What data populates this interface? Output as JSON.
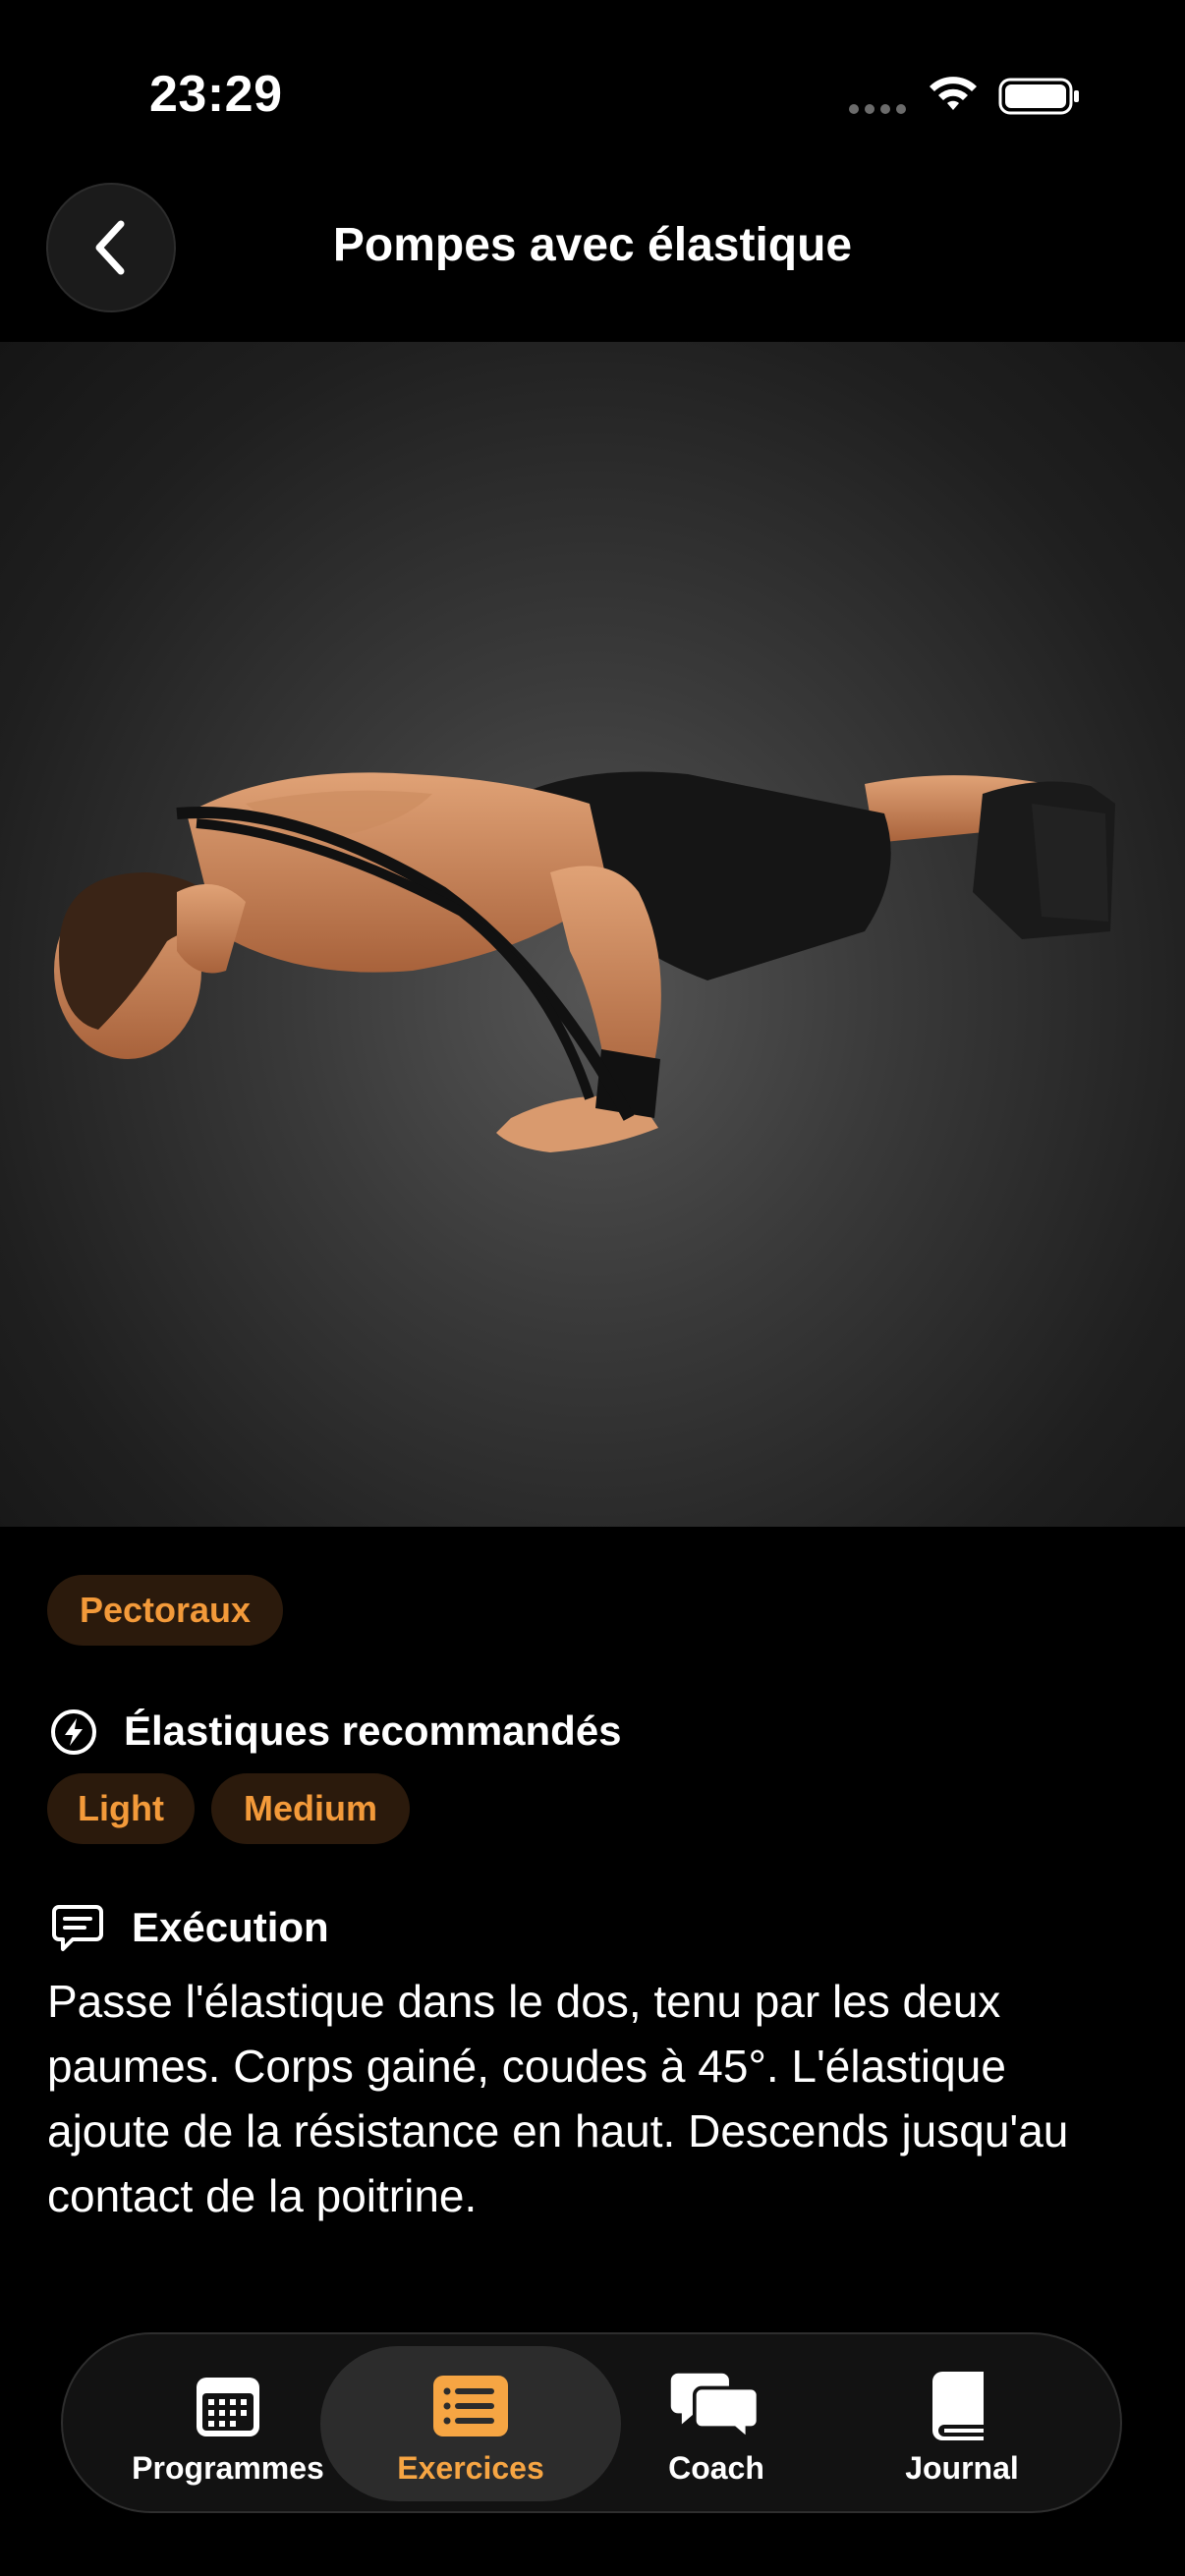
{
  "status_bar": {
    "time": "23:29"
  },
  "header": {
    "title": "Pompes avec élastique",
    "back_icon": "chevron-left-icon"
  },
  "hero": {
    "image_description_icon": "exercise-photo"
  },
  "muscle_tag": "Pectoraux",
  "bands_section": {
    "heading": "Élastiques recommandés",
    "icon": "bolt-circle-icon",
    "bands": [
      "Light",
      "Medium"
    ]
  },
  "execution_section": {
    "heading": "Exécution",
    "icon": "speech-bubble-icon",
    "text": "Passe l'élastique dans le dos, tenu par les deux paumes. Corps gainé, coudes à 45°. L'élastique ajoute de la résistance en haut. Descends jusqu'au contact de la poitrine."
  },
  "tab_bar": {
    "tabs": [
      {
        "label": "Programmes",
        "icon": "calendar-icon",
        "active": false
      },
      {
        "label": "Exercices",
        "icon": "list-icon",
        "active": true
      },
      {
        "label": "Coach",
        "icon": "chat-bubbles-icon",
        "active": false
      },
      {
        "label": "Journal",
        "icon": "book-icon",
        "active": false
      }
    ]
  },
  "colors": {
    "accent": "#f6a543",
    "chip_bg": "#2b1a0c",
    "background": "#000000"
  }
}
